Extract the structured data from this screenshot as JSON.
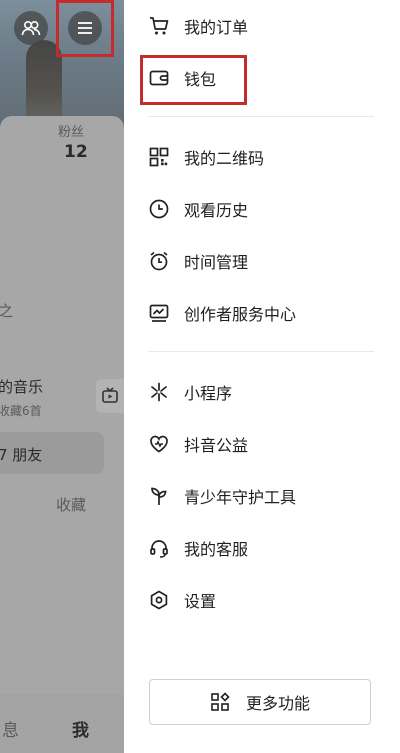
{
  "background": {
    "fans_label": "粉丝",
    "fans_count": "12",
    "partial_char": "之",
    "music_title": "的音乐",
    "music_sub": "收藏6首",
    "friends_text": "7 朋友",
    "collect_label": "收藏",
    "nav_messages_partial": "息",
    "nav_me": "我"
  },
  "drawer": {
    "menu": [
      {
        "label": "我的订单",
        "icon": "cart-icon"
      },
      {
        "label": "钱包",
        "icon": "wallet-icon"
      },
      {
        "label": "我的二维码",
        "icon": "qrcode-icon"
      },
      {
        "label": "观看历史",
        "icon": "clock-icon"
      },
      {
        "label": "时间管理",
        "icon": "alarm-icon"
      },
      {
        "label": "创作者服务中心",
        "icon": "chart-icon"
      },
      {
        "label": "小程序",
        "icon": "mini-program-icon"
      },
      {
        "label": "抖音公益",
        "icon": "charity-heart-icon"
      },
      {
        "label": "青少年守护工具",
        "icon": "sprout-icon"
      },
      {
        "label": "我的客服",
        "icon": "headset-icon"
      },
      {
        "label": "设置",
        "icon": "settings-icon"
      }
    ],
    "more_button": "更多功能"
  },
  "highlight_color": "#c42b2b"
}
